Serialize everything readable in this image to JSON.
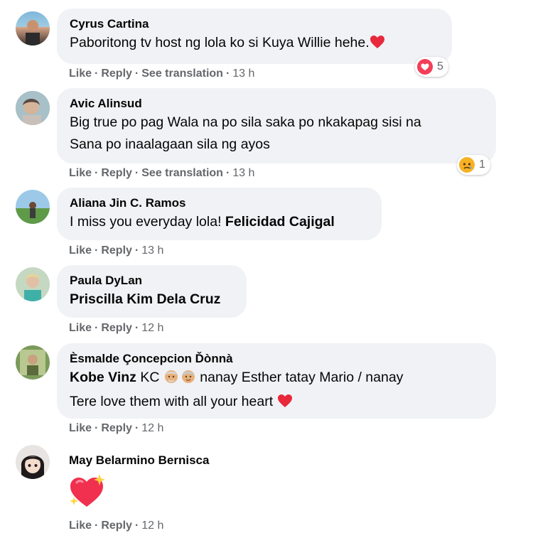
{
  "comments": [
    {
      "author": "Cyrus Cartina",
      "text": "Paboritong tv host ng lola ko si Kuya Willie hehe.",
      "like": "Like",
      "reply": "Reply",
      "translate": "See translation",
      "time": "13 h",
      "reaction_icon": "heart-reaction",
      "reaction_count": "5"
    },
    {
      "author": "Avic Alinsud",
      "text_line1": "Big true po pag Wala na po sila saka po nkakapag sisi na",
      "text_line2": "Sana po inaalagaan sila ng ayos",
      "like": "Like",
      "reply": "Reply",
      "translate": "See translation",
      "time": "13 h",
      "reaction_icon": "sad-reaction",
      "reaction_count": "1"
    },
    {
      "author": "Aliana Jin C. Ramos",
      "text": "I miss you everyday lola! ",
      "mention": "Felicidad Cajigal",
      "like": "Like",
      "reply": "Reply",
      "time": "13 h"
    },
    {
      "author": "Paula DyLan",
      "mention": "Priscilla Kim Dela Cruz",
      "like": "Like",
      "reply": "Reply",
      "time": "12 h"
    },
    {
      "author": "Èsmalde Çoncepcion Ďònnà",
      "mention": "Kobe Vinz",
      "text_line1": " KC ",
      "text_line1b": " nanay Esther tatay Mario / nanay",
      "text_line2": "Tere love them with all your heart ",
      "like": "Like",
      "reply": "Reply",
      "time": "12 h"
    },
    {
      "author": "May Belarmino Bernisca",
      "emoji": "sparkling-heart",
      "like": "Like",
      "reply": "Reply",
      "time": "12 h"
    }
  ],
  "colors": {
    "bubble": "#f0f2f5",
    "meta": "#65676b",
    "heart": "#f33e58",
    "sad": "#f7b125"
  }
}
